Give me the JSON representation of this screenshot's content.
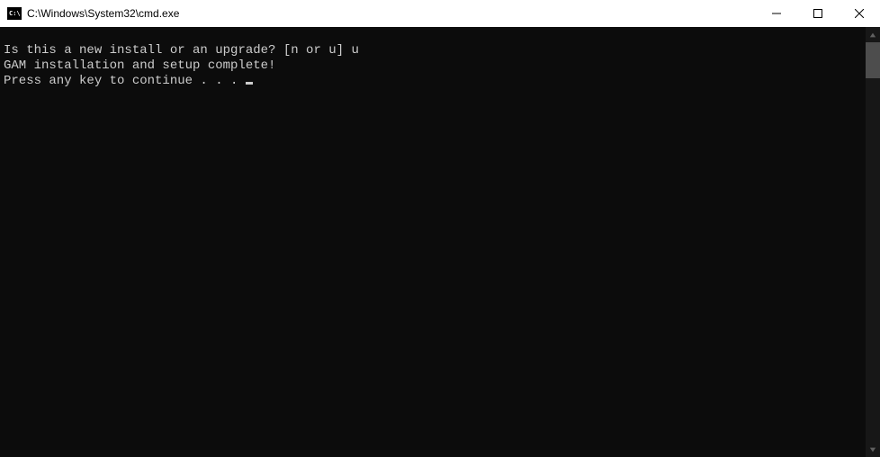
{
  "titlebar": {
    "icon_label": "C:\\",
    "title": "C:\\Windows\\System32\\cmd.exe"
  },
  "terminal": {
    "line1": "Is this a new install or an upgrade? [n or u] u",
    "line2": "GAM installation and setup complete!",
    "line3": "Press any key to continue . . . "
  }
}
